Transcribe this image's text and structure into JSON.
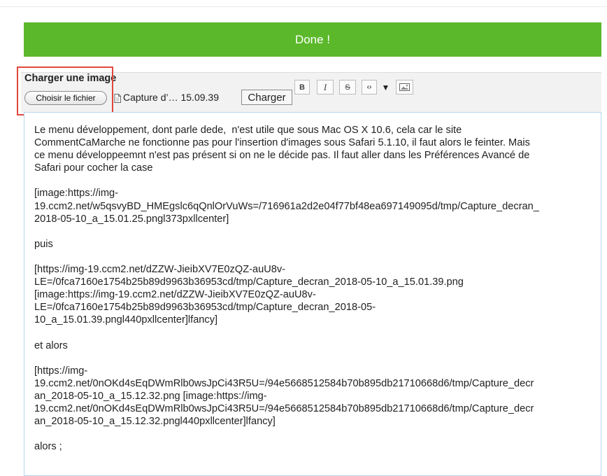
{
  "done_bar": {
    "label": "Done !"
  },
  "upload": {
    "title": "Charger une image",
    "choose_file_label": "Choisir le fichier",
    "file_name": "Capture d’… 15.09.39",
    "submit_label": "Charger"
  },
  "toolbar": {
    "bold": "B",
    "italic": "I",
    "strike": "S",
    "code": "‹›",
    "dropdown": "▼",
    "image": "image"
  },
  "editor": {
    "content": "Le menu développement, dont parle dede,  n'est utile que sous Mac OS X 10.6, cela car le site\nCommentCaMarche ne fonctionne pas pour l'insertion d'images sous Safari 5.1.10, il faut alors le feinter. Mais\nce menu développeemnt n'est pas présent si on ne le décide pas. Il faut aller dans les Préférences Avancé de\nSafari pour cocher la case\n\n[image:https://img-\n19.ccm2.net/w5qsvyBD_HMEgslc6qQnlOrVuWs=/716961a2d2e04f77bf48ea697149095d/tmp/Capture_decran_\n2018-05-10_a_15.01.25.pngl373pxllcenter]\n\npuis\n\n[https://img-19.ccm2.net/dZZW-JieibXV7E0zQZ-auU8v-\nLE=/0fca7160e1754b25b89d9963b36953cd/tmp/Capture_decran_2018-05-10_a_15.01.39.png\n[image:https://img-19.ccm2.net/dZZW-JieibXV7E0zQZ-auU8v-\nLE=/0fca7160e1754b25b89d9963b36953cd/tmp/Capture_decran_2018-05-\n10_a_15.01.39.pngl440pxllcenter]lfancy]\n\net alors\n\n[https://img-\n19.ccm2.net/0nOKd4sEqDWmRlb0wsJpCi43R5U=/94e5668512584b70b895db21710668d6/tmp/Capture_decr\nan_2018-05-10_a_15.12.32.png [image:https://img-\n19.ccm2.net/0nOKd4sEqDWmRlb0wsJpCi43R5U=/94e5668512584b70b895db21710668d6/tmp/Capture_decr\nan_2018-05-10_a_15.12.32.pngl440pxllcenter]lfancy]\n\nalors ;"
  },
  "colors": {
    "done_green": "#5cb82b",
    "highlight_red": "#e0473b",
    "editor_border": "#b9d7ee",
    "panel_bg": "#f2f2f2"
  }
}
